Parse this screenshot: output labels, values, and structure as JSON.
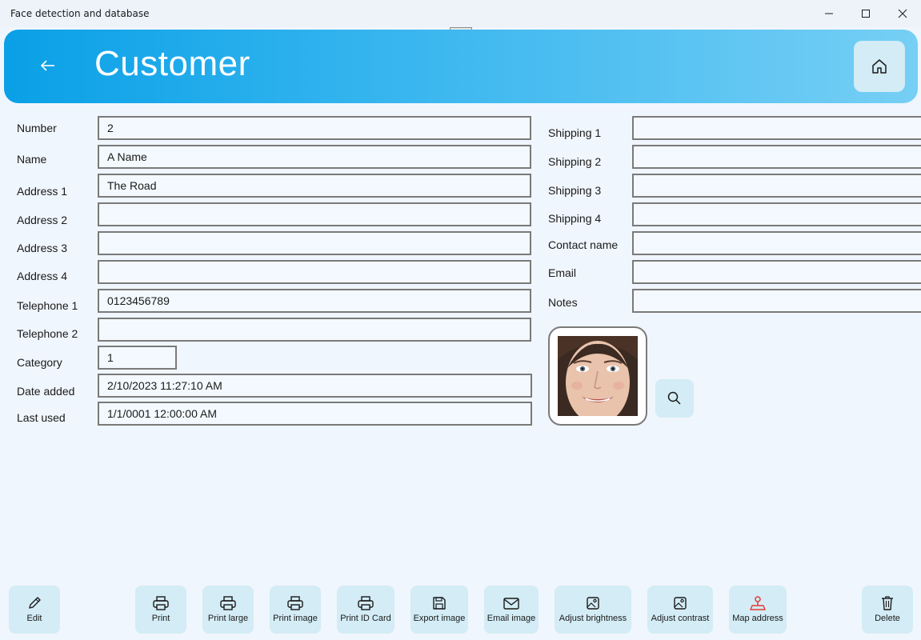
{
  "window": {
    "title": "Face detection and database"
  },
  "header": {
    "title": "Customer"
  },
  "fields_left": [
    {
      "label": "Number",
      "value": "2"
    },
    {
      "label": "Name",
      "value": "A Name"
    },
    {
      "label": "Address 1",
      "value": "The Road"
    },
    {
      "label": "Address 2",
      "value": ""
    },
    {
      "label": "Address 3",
      "value": ""
    },
    {
      "label": "Address 4",
      "value": ""
    },
    {
      "label": "Telephone 1",
      "value": "0123456789"
    },
    {
      "label": "Telephone 2",
      "value": ""
    },
    {
      "label": "Category",
      "value": "1"
    },
    {
      "label": "Date added",
      "value": "2/10/2023 11:27:10 AM"
    },
    {
      "label": "Last used",
      "value": "1/1/0001 12:00:00 AM"
    }
  ],
  "fields_right": [
    {
      "label": "Shipping 1",
      "value": ""
    },
    {
      "label": "Shipping 2",
      "value": ""
    },
    {
      "label": "Shipping 3",
      "value": ""
    },
    {
      "label": "Shipping 4",
      "value": ""
    },
    {
      "label": "Contact name",
      "value": ""
    },
    {
      "label": "Email",
      "value": ""
    },
    {
      "label": "Notes",
      "value": ""
    }
  ],
  "toolbar": {
    "edit": "Edit",
    "print": "Print",
    "print_large": "Print large",
    "print_image": "Print image",
    "print_id_card": "Print ID Card",
    "export_image": "Export image",
    "email_image": "Email image",
    "adjust_brightness": "Adjust brightness",
    "adjust_contrast": "Adjust contrast",
    "map_address": "Map address",
    "delete": "Delete"
  },
  "icons": {
    "back": "arrow-left-icon",
    "home": "home-icon",
    "search": "search-icon",
    "map": "map-pin-icon"
  },
  "colors": {
    "header_start": "#0aa0e6",
    "header_end": "#76cff4",
    "button_bg": "#d3ecf5",
    "map_icon": "#e53935"
  }
}
